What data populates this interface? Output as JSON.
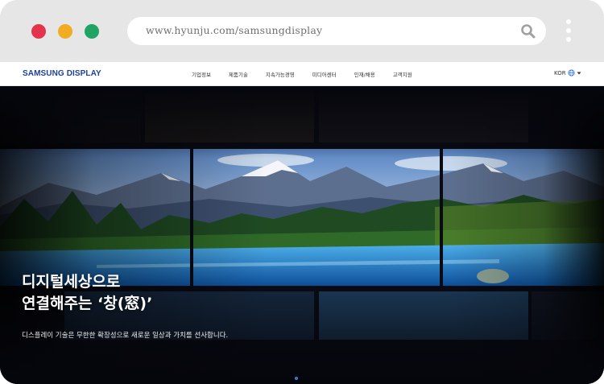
{
  "window": {
    "url": "www.hyunju.com/samsungdisplay",
    "icons": [
      "close-dot",
      "minimize-dot",
      "maximize-dot",
      "search-icon",
      "more-icon"
    ]
  },
  "nav": {
    "logo": "SAMSUNG DISPLAY",
    "items": [
      "기업정보",
      "제품기술",
      "지속가능경영",
      "미디어센터",
      "인재/채용",
      "고객지원"
    ],
    "language": "KOR"
  },
  "hero": {
    "headline_line1": "디지털세상으로",
    "headline_line2": "연결해주는 ‘창(窓)’",
    "subtext": "디스플레이 기술은 무한한 확장성으로 새로운 일상과 가치를 선사합니다."
  },
  "colors": {
    "brand": "#1b3f9a",
    "chrome": "#e6e6e6",
    "dot_red": "#e4334c",
    "dot_yellow": "#f2ac22",
    "dot_green": "#1fa463",
    "indicator": "#3a78d8"
  }
}
